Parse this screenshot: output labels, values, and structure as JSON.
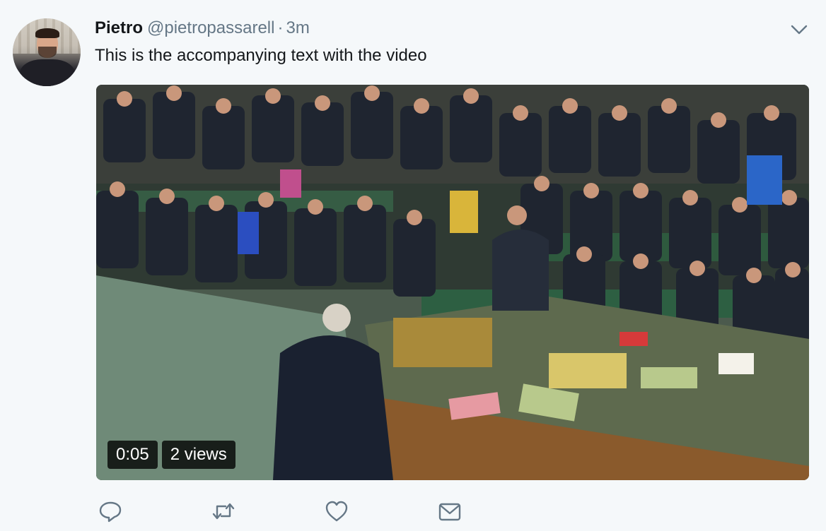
{
  "tweet": {
    "author": {
      "name": "Pietro",
      "handle": "@pietropassarell",
      "separator": "·",
      "time": "3m"
    },
    "text": "This is the accompanying text with the video",
    "video": {
      "duration": "0:05",
      "views": "2 views"
    },
    "actions": {
      "reply_icon": "reply-icon",
      "retweet_icon": "retweet-icon",
      "like_icon": "like-icon",
      "message_icon": "message-icon"
    },
    "colors": {
      "background": "#f5f8fa",
      "text": "#14171a",
      "secondary": "#657786",
      "badge_bg": "rgba(0,0,0,0.78)"
    }
  }
}
